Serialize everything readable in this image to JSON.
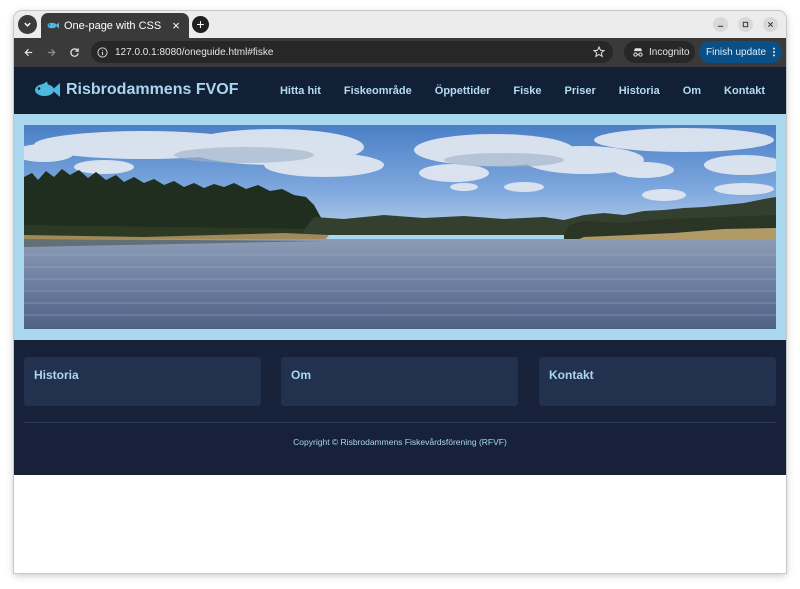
{
  "browser": {
    "tab_title": "One-page with CSS",
    "tab_close": "×",
    "new_tab": "+",
    "url": "127.0.0.1:8080/oneguide.html#fiske",
    "incognito_label": "Incognito",
    "finish_update_label": "Finish update"
  },
  "site": {
    "logo_text": "Risbrodammens FVOF",
    "nav": [
      "Hitta hit",
      "Fiskeområde",
      "Öppettider",
      "Fiske",
      "Priser",
      "Historia",
      "Om",
      "Kontakt"
    ],
    "cards": [
      "Historia",
      "Om",
      "Kontakt"
    ],
    "copyright": "Copyright © Risbrodammens Fiskevårdsförening (RFVF)"
  },
  "colors": {
    "header_bg": "#112035",
    "accent": "#a9d6ef",
    "hero_border": "#a9d8ee",
    "content_bg": "#172139",
    "card_bg": "#22324e",
    "browser_accent": "#0b4f87"
  },
  "icons": {
    "logo": "fish-icon",
    "tab_favicon": "fish-icon",
    "tab_menu": "chevron-down-icon",
    "back": "arrow-left-icon",
    "forward": "arrow-right-icon",
    "reload": "reload-icon",
    "site_info": "info-icon",
    "bookmark": "star-icon",
    "incognito": "incognito-icon",
    "update_menu": "kebab-menu-icon"
  }
}
